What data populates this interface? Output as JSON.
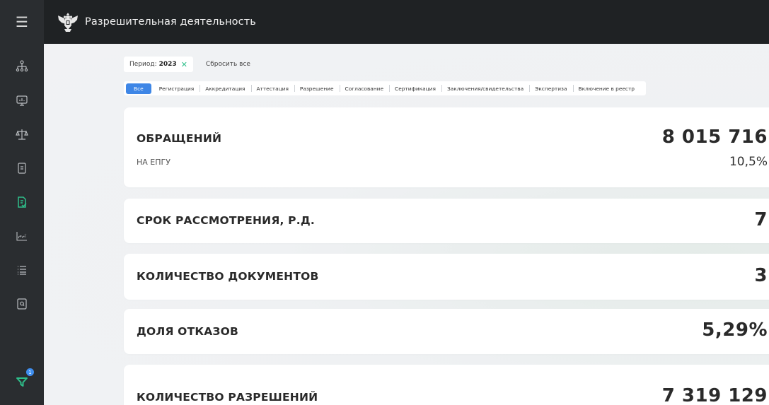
{
  "app": {
    "title": "Разрешительная деятельность"
  },
  "sidebar": {
    "items": [
      {
        "icon": "org-structure-icon"
      },
      {
        "icon": "monitor-icon"
      },
      {
        "icon": "scales-icon"
      },
      {
        "icon": "document-icon"
      },
      {
        "icon": "document-check-icon",
        "active": true
      },
      {
        "icon": "chart-icon"
      },
      {
        "icon": "list-icon"
      },
      {
        "icon": "document-search-icon"
      }
    ],
    "filter": {
      "icon": "filter-icon",
      "badge": "1"
    },
    "accent_active": "#2ebf8a"
  },
  "filters": {
    "period_label": "Период:",
    "period_value": "2023",
    "reset_label": "Сбросить все"
  },
  "tabs": [
    {
      "label": "Все",
      "active": true
    },
    {
      "label": "Регистрация"
    },
    {
      "label": "Аккредитация"
    },
    {
      "label": "Аттестация"
    },
    {
      "label": "Разрешение"
    },
    {
      "label": "Согласование"
    },
    {
      "label": "Сертификация"
    },
    {
      "label": "Заключения/свидетельства"
    },
    {
      "label": "Экспертиза"
    },
    {
      "label": "Включение в реестр"
    }
  ],
  "cards": [
    {
      "label": "ОБРАЩЕНИЙ",
      "value": "8 015 716",
      "sub_label": "НА ЕПГУ",
      "sub_value": "10,5%"
    },
    {
      "label": "СРОК РАССМОТРЕНИЯ, Р.Д.",
      "value": "7"
    },
    {
      "label": "КОЛИЧЕСТВО ДОКУМЕНТОВ",
      "value": "3"
    },
    {
      "label": "ДОЛЯ ОТКАЗОВ",
      "value": "5,29%"
    },
    {
      "label": "КОЛИЧЕСТВО РАЗРЕШЕНИЙ",
      "value": "7 319 129"
    }
  ],
  "colors": {
    "topbar": "#1f2224",
    "sidebar": "#2a2d30",
    "tab_active": "#3e86e6",
    "close_x": "#2ebf8a",
    "badge": "#3f8ff0"
  }
}
